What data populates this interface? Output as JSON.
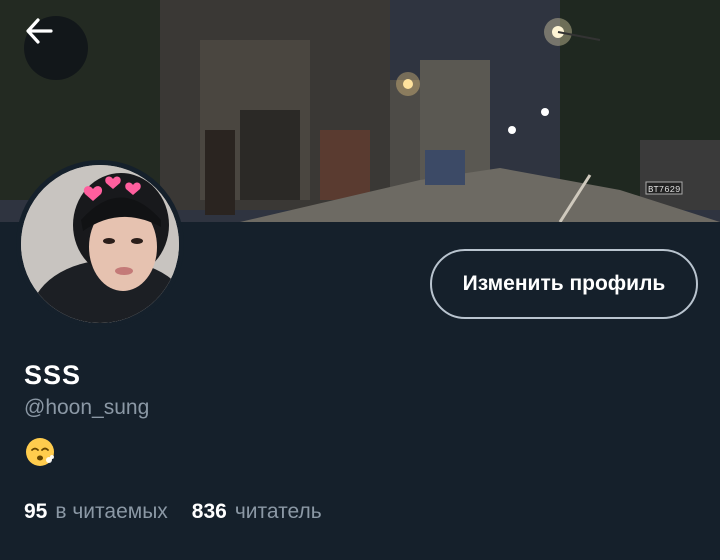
{
  "profile": {
    "display_name": "SSS",
    "handle": "@hoon_sung",
    "bio_emoji": "face-exhaling-emoji",
    "edit_button_label": "Изменить профиль",
    "banner_sign_text": "BT7629"
  },
  "stats": {
    "following_count": "95",
    "following_label": "в читаемых",
    "followers_count": "836",
    "followers_label": "читатель"
  },
  "icons": {
    "back": "back-arrow-icon"
  },
  "colors": {
    "background": "#15202b",
    "secondary_text": "#8b98a5",
    "button_border": "#b9c4cf"
  }
}
